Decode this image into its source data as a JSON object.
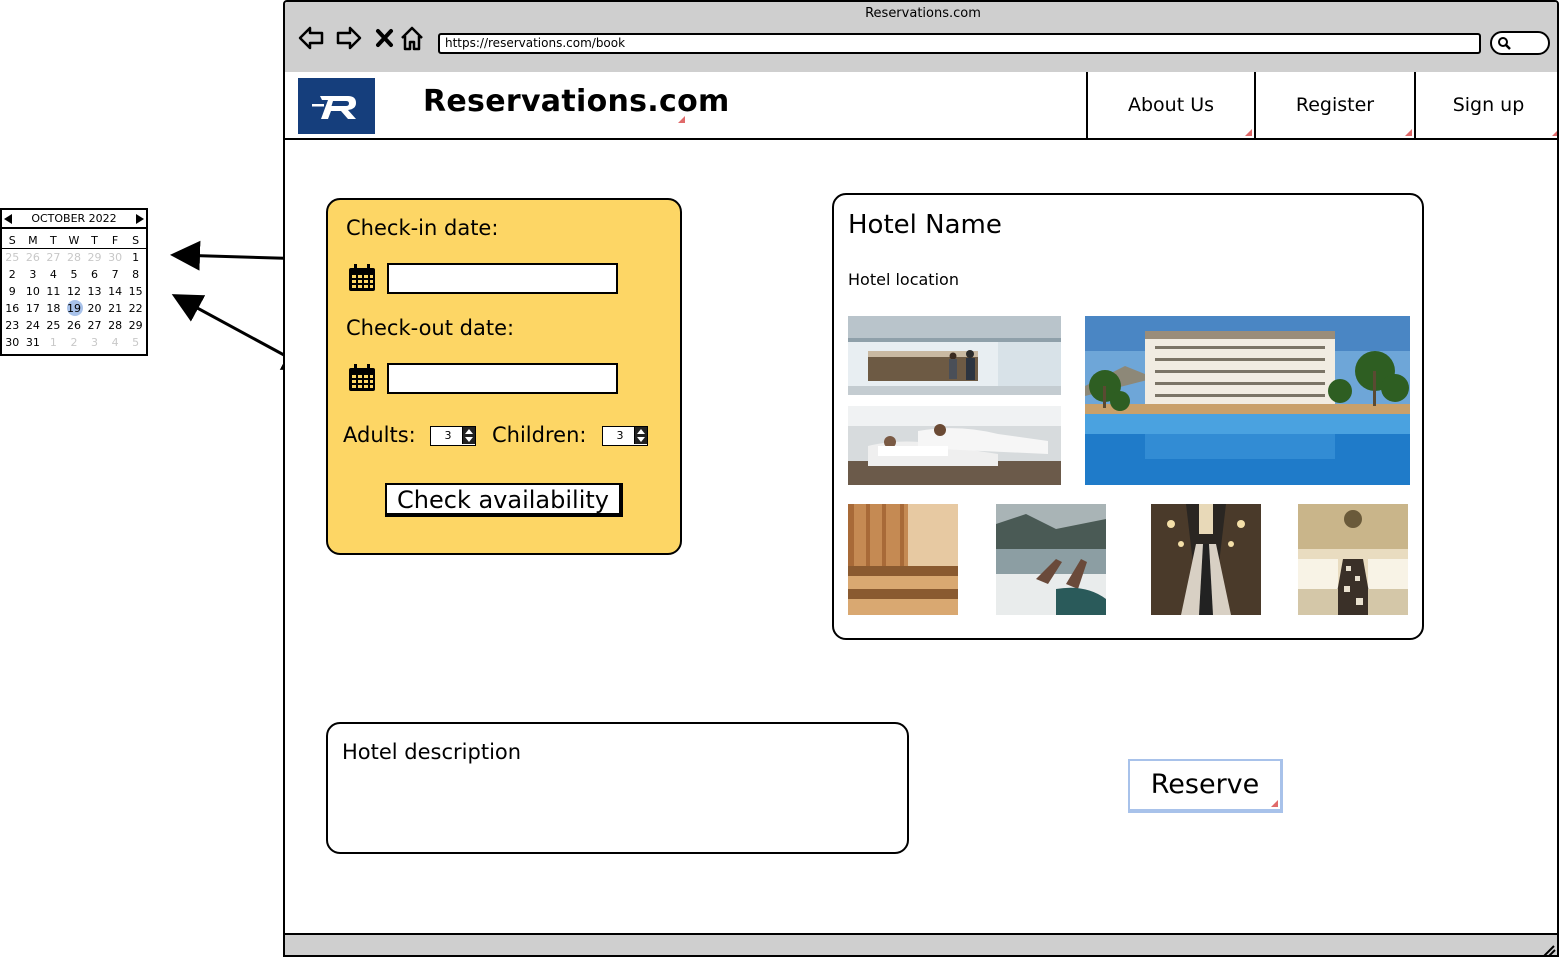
{
  "window": {
    "title": "Reservations.com",
    "url": "https://reservations.com/book"
  },
  "header": {
    "site_title": "Reservations.com",
    "nav": [
      {
        "label": "About Us"
      },
      {
        "label": "Register"
      },
      {
        "label": "Sign up"
      }
    ]
  },
  "booking": {
    "checkin_label": "Check-in date:",
    "checkin_value": "",
    "checkout_label": "Check-out date:",
    "checkout_value": "",
    "adults_label": "Adults:",
    "adults_value": "3",
    "children_label": "Children:",
    "children_value": "3",
    "check_button": "Check availability"
  },
  "hotel": {
    "name": "Hotel Name",
    "location": "Hotel location",
    "photos": [
      "lobby-reception",
      "spa-loungers",
      "resort-pool",
      "sauna",
      "lake-view-feet",
      "dining-hall",
      "banquet-room"
    ]
  },
  "description": {
    "title": "Hotel description"
  },
  "reserve_button": "Reserve",
  "calendar": {
    "month": "OCTOBER 2022",
    "weekdays": [
      "S",
      "M",
      "T",
      "W",
      "T",
      "F",
      "S"
    ],
    "weeks": [
      [
        "25",
        "26",
        "27",
        "28",
        "29",
        "30",
        "1"
      ],
      [
        "2",
        "3",
        "4",
        "5",
        "6",
        "7",
        "8"
      ],
      [
        "9",
        "10",
        "11",
        "12",
        "13",
        "14",
        "15"
      ],
      [
        "16",
        "17",
        "18",
        "19",
        "20",
        "21",
        "22"
      ],
      [
        "23",
        "24",
        "25",
        "26",
        "27",
        "28",
        "29"
      ],
      [
        "30",
        "31",
        "1",
        "2",
        "3",
        "4",
        "5"
      ]
    ],
    "selected": "19",
    "selected_color": "#a8c2ea"
  },
  "colors": {
    "booking_panel": "#fdd665",
    "logo_bg": "#153e7c",
    "chrome_gray": "#cfcfcf"
  }
}
